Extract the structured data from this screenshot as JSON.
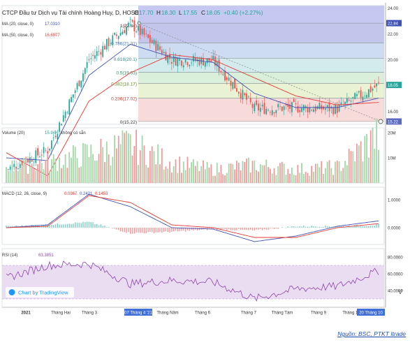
{
  "header": {
    "title": "CTCP Đầu tư Dịch vụ Tài chính Hoàng Huy, D, HOSE",
    "o_label": "O",
    "o_value": "17.70",
    "h_label": "H",
    "h_value": "18.30",
    "l_label": "L",
    "l_value": "17.55",
    "c_label": "C",
    "c_value": "18.05",
    "change": "+0.40 (+2.27%)"
  },
  "legends": {
    "ma20_label": "MA (20, close, 0)",
    "ma20_value": "17.0310",
    "ma50_label": "MA (50, close, 0)",
    "ma50_value": "16.6977",
    "volume_label": "Volume (20)",
    "volume_value": "15.94K",
    "volume_extra": "không có sẵn",
    "macd_label": "MACD (12, 26, close, 9)",
    "macd_v1": "0.0967",
    "macd_v2": "0.2421",
    "macd_v3": "0.1453",
    "rsi_label": "RSI (14)",
    "rsi_value": "63.3851",
    "tradingview": "Chart by TradingView"
  },
  "fib_labels": [
    "1(22.84)",
    "0.786(21.31)",
    "0.618(20.1)",
    "0.5(19.03)",
    "0.382(18.17)",
    "0.236(17.02)",
    "0(15.22)"
  ],
  "price_axis": [
    "24.00",
    "22.84",
    "22.00",
    "20.00",
    "18.05",
    "16.00",
    "15.22"
  ],
  "volume_axis": [
    "20M",
    "10M"
  ],
  "macd_axis": [
    "1.0000",
    "0.0000"
  ],
  "rsi_axis": [
    "80.0000",
    "60.0000",
    "40.0000"
  ],
  "time_axis": [
    "2021",
    "Tháng Hai",
    "Tháng 3",
    "07 Tháng 4 '21",
    "Tháng Năm",
    "Tháng 6",
    "Tháng 7",
    "Tháng Tám",
    "Tháng 9",
    "Tháng 10",
    "20 Tháng 10"
  ],
  "side_letter": "V",
  "source": "Nguồn: BSC, PTKT Itrade",
  "colors": {
    "up": "#26a69a",
    "down": "#ef5350",
    "ma20": "#3f51b5",
    "ma50": "#e53935",
    "macd": "#3f51b5",
    "signal": "#e53935",
    "rsi": "#8e44ad",
    "rsiband": "#eadcf1",
    "volup": "#a5d6a7",
    "voldown": "#ef9a9a"
  },
  "chart_data": [
    {
      "type": "line",
      "title": "CTCP Đầu tư Dịch vụ Tài chính Hoàng Huy, D, HOSE",
      "xlabel": "",
      "ylabel": "",
      "ylim": [
        15,
        24.2
      ],
      "x": [
        "2021",
        "Tháng Hai",
        "Tháng 3",
        "07 Tháng 4 '21",
        "Tháng Năm",
        "Tháng 6",
        "Tháng 7",
        "Tháng Tám",
        "Tháng 9",
        "Tháng 10"
      ],
      "series": [
        {
          "name": "C",
          "values": [
            11.5,
            13.0,
            20.0,
            22.8,
            20.0,
            19.9,
            16.2,
            16.3,
            16.2,
            18.05
          ]
        },
        {
          "name": "MA (20, close, 0)",
          "values": [
            12.4,
            12.2,
            18.8,
            21.2,
            20.2,
            19.8,
            17.4,
            16.3,
            16.3,
            17.03
          ]
        },
        {
          "name": "MA (50, close, 0)",
          "values": [
            12.8,
            11.0,
            16.8,
            19.0,
            20.4,
            20.0,
            18.6,
            17.2,
            16.5,
            16.7
          ]
        }
      ],
      "fibonacci": [
        {
          "level": "1",
          "price": 22.84
        },
        {
          "level": "0.786",
          "price": 21.31
        },
        {
          "level": "0.618",
          "price": 20.1
        },
        {
          "level": "0.5",
          "price": 19.03
        },
        {
          "level": "0.382",
          "price": 18.17
        },
        {
          "level": "0.236",
          "price": 17.02
        },
        {
          "level": "0",
          "price": 15.22
        }
      ],
      "last": {
        "O": 17.7,
        "H": 18.3,
        "L": 17.55,
        "C": 18.05
      }
    },
    {
      "type": "bar",
      "title": "Volume (20)",
      "xlabel": "",
      "ylabel": "",
      "ylim": [
        0,
        22
      ],
      "categories": [
        "2021",
        "Tháng Hai",
        "Tháng 3",
        "07 Tháng 4 '21",
        "Tháng Năm",
        "Tháng 6",
        "Tháng 7",
        "Tháng Tám",
        "Tháng 9",
        "Tháng 10"
      ],
      "values": [
        7,
        9,
        13,
        17,
        9,
        6,
        8,
        6,
        7,
        21
      ]
    },
    {
      "type": "line",
      "title": "MACD (12, 26, close, 9)",
      "xlabel": "",
      "ylabel": "",
      "ylim": [
        -0.6,
        1.45
      ],
      "x": [
        "2021",
        "Tháng Hai",
        "Tháng 3",
        "07 Tháng 4 '21",
        "Tháng Năm",
        "Tháng 6",
        "Tháng 7",
        "Tháng Tám",
        "Tháng 9",
        "Tháng 10"
      ],
      "series": [
        {
          "name": "MACD",
          "values": [
            0.0,
            0.1,
            1.2,
            0.75,
            0.0,
            -0.05,
            -0.5,
            -0.3,
            0.05,
            0.2421
          ]
        },
        {
          "name": "Signal",
          "values": [
            0.0,
            0.05,
            1.15,
            0.9,
            0.1,
            0.0,
            -0.35,
            -0.35,
            0.0,
            0.1453
          ]
        },
        {
          "name": "Histogram",
          "values": [
            0.05,
            0.1,
            0.2,
            -0.2,
            -0.15,
            -0.05,
            -0.1,
            0.05,
            0.05,
            0.0967
          ]
        }
      ]
    },
    {
      "type": "line",
      "title": "RSI (14)",
      "xlabel": "",
      "ylabel": "",
      "ylim": [
        20,
        90
      ],
      "x": [
        "2021",
        "Tháng Hai",
        "Tháng 3",
        "07 Tháng 4 '21",
        "Tháng Năm",
        "Tháng 6",
        "Tháng 7",
        "Tháng Tám",
        "Tháng 9",
        "Tháng 10"
      ],
      "series": [
        {
          "name": "RSI (14)",
          "values": [
            55,
            70,
            72,
            48,
            52,
            50,
            30,
            42,
            45,
            63.3851
          ]
        }
      ],
      "bands": [
        30,
        70
      ]
    }
  ]
}
